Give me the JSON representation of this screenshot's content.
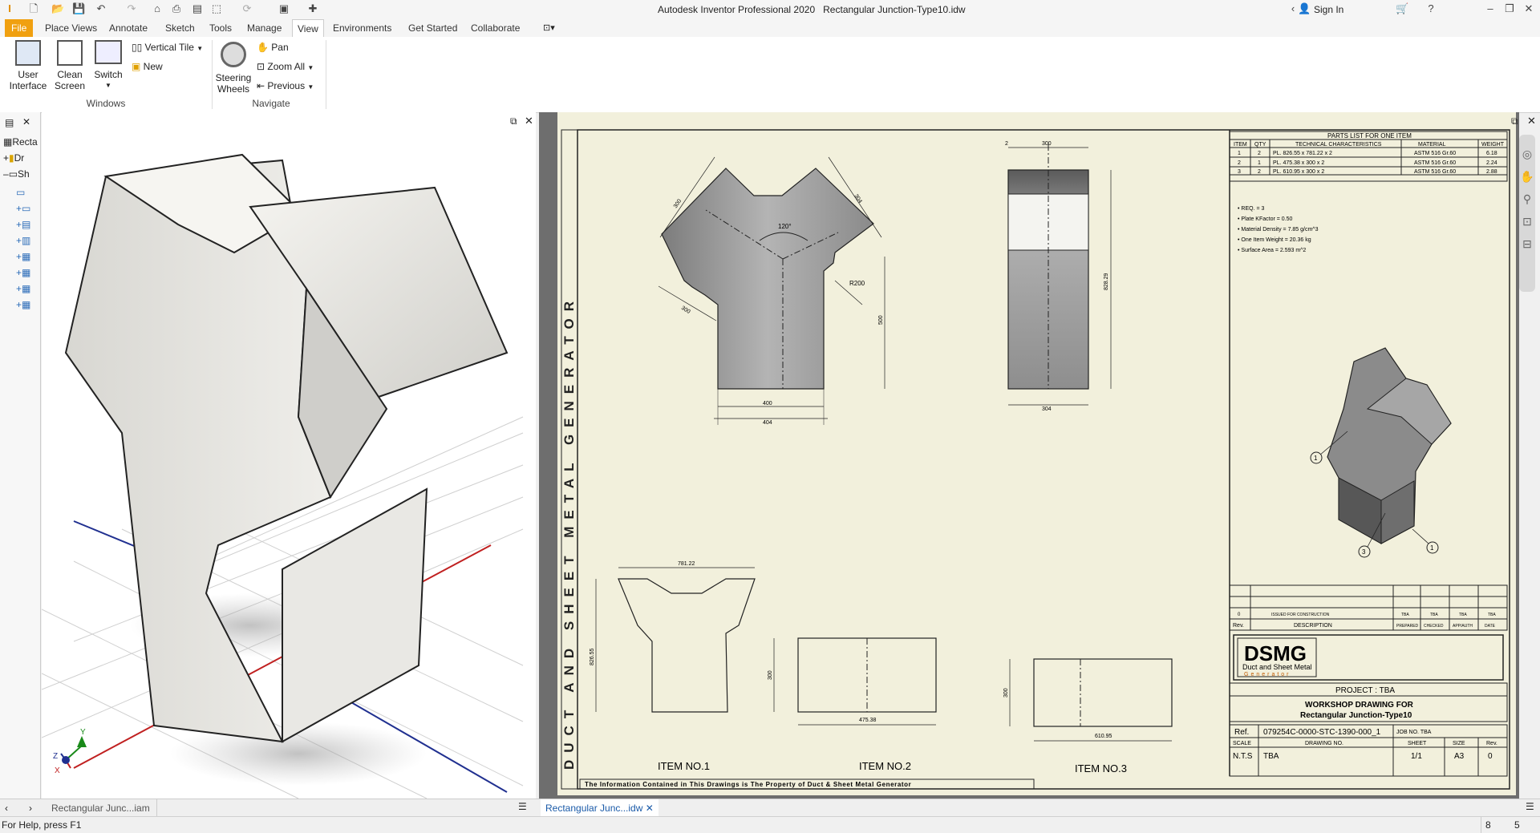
{
  "app": {
    "title": "Autodesk Inventor Professional 2020",
    "document_title": "Rectangular Junction-Type10.idw",
    "sign_in": "Sign In"
  },
  "tabs": [
    "File",
    "Place Views",
    "Annotate",
    "Sketch",
    "Tools",
    "Manage",
    "View",
    "Environments",
    "Get Started",
    "Collaborate"
  ],
  "active_tab": "View",
  "ribbon": {
    "windows": {
      "user_interface": [
        "User",
        "Interface"
      ],
      "clean_screen": [
        "Clean",
        "Screen"
      ],
      "switch": "Switch",
      "vertical_tile": "Vertical Tile",
      "new": "New",
      "label": "Windows"
    },
    "navigate": {
      "steering_wheels": [
        "Steering",
        "Wheels"
      ],
      "pan": "Pan",
      "zoom_all": "Zoom All",
      "previous": "Previous",
      "label": "Navigate"
    }
  },
  "browser": {
    "items": [
      "Recta",
      "Dr",
      "Sh"
    ]
  },
  "drawing": {
    "side_title": "DUCT AND SHEET METAL GENERATOR",
    "footer_note": "The Information Contained in This Drawings is The Property of Duct & Sheet Metal Generator",
    "parts_list_title": "PARTS LIST FOR ONE ITEM",
    "parts_headers": [
      "ITEM",
      "QTY",
      "TECHNICAL CHARACTERISTICS",
      "MATERIAL",
      "WEIGHT"
    ],
    "parts_rows": [
      [
        "1",
        "2",
        "PL. 826.55 x 781.22 x 2",
        "ASTM 516 Gr.60",
        "6.18"
      ],
      [
        "2",
        "1",
        "PL. 475.38 x 300 x 2",
        "ASTM 516 Gr.60",
        "2.24"
      ],
      [
        "3",
        "2",
        "PL. 610.95 x 300 x 2",
        "ASTM 516 Gr.60",
        "2.88"
      ]
    ],
    "notes": [
      "REQ. = 3",
      "Plate KFactor = 0.50",
      "Material Density = 7.85 g/cm^3",
      "One Item Weight = 20.36 kg",
      "Surface Area = 2.593 m^2"
    ],
    "front_dims": {
      "top_left": "300",
      "top_right": "304",
      "angle": "120°",
      "radius": "R200",
      "height": "500",
      "bottom1": "400",
      "bottom2": "404",
      "left_low": "300"
    },
    "side_dims": {
      "top": "300",
      "top_small": "2",
      "height": "828.29",
      "bottom": "304"
    },
    "item1": {
      "label": "ITEM NO.1",
      "width": "781.22",
      "height": "826.55"
    },
    "item2": {
      "label": "ITEM NO.2",
      "width": "475.38",
      "height": "300"
    },
    "item3": {
      "label": "ITEM NO.3",
      "width": "610.95",
      "height": "300"
    },
    "balloons": [
      "1",
      "3",
      "1"
    ],
    "revision": {
      "rev": "0",
      "description": "ISSUED FOR CONSTRUCTION",
      "tba": [
        "TBA",
        "TBA",
        "TBA",
        "TBA"
      ],
      "headers": [
        "Rev.",
        "DESCRIPTION",
        "PREPARED",
        "CHECKED",
        "APP/AUTH",
        "DATE"
      ]
    },
    "logo": {
      "main": "DSMG",
      "line1": "Duct and Sheet Metal",
      "line2": "Generator"
    },
    "project": "PROJECT : TBA",
    "workshop_title": "WORKSHOP DRAWING FOR",
    "workshop_sub": "Rectangular Junction-Type10",
    "ref_label": "Ref.",
    "ref_value": "079254C-0000-STC-1390-000_1",
    "job_no": "JOB NO. TBA",
    "tb_headers": [
      "SCALE",
      "DRAWING NO.",
      "SHEET",
      "SIZE",
      "Rev."
    ],
    "tb_values": [
      "N.T.S",
      "TBA",
      "1/1",
      "A3",
      "0"
    ]
  },
  "doc_tabs": [
    "Rectangular Junc...iam",
    "Rectangular Junc...idw"
  ],
  "status": {
    "help": "For Help, press F1",
    "n1": "8",
    "n2": "5"
  },
  "colors": {
    "file_tab": "#f0a010",
    "sheet": "#f2f0dc",
    "active_doc_tab": "#1a73c8"
  }
}
